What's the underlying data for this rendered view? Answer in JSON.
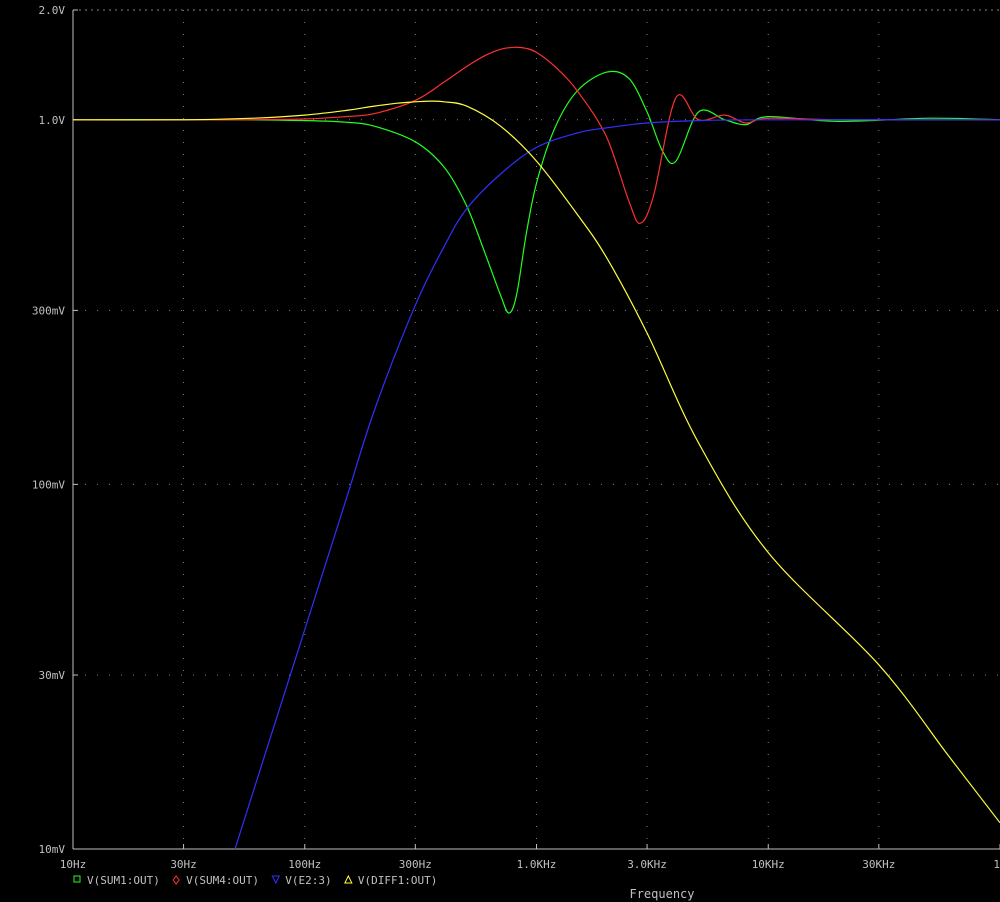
{
  "chart_data": {
    "type": "line",
    "xlabel": "Frequency",
    "xscale": "log",
    "yscale": "log",
    "xlim": [
      10,
      100000
    ],
    "ylim": [
      0.01,
      2.0
    ],
    "x_ticks": [
      {
        "value": 10,
        "label": "10Hz"
      },
      {
        "value": 30,
        "label": "30Hz"
      },
      {
        "value": 100,
        "label": "100Hz"
      },
      {
        "value": 300,
        "label": "300Hz"
      },
      {
        "value": 1000,
        "label": "1.0KHz"
      },
      {
        "value": 3000,
        "label": "3.0KHz"
      },
      {
        "value": 10000,
        "label": "10KHz"
      },
      {
        "value": 30000,
        "label": "30KHz"
      },
      {
        "value": 100000,
        "label": "1"
      }
    ],
    "y_ticks": [
      {
        "value": 2.0,
        "label": "2.0V"
      },
      {
        "value": 1.0,
        "label": "1.0V"
      },
      {
        "value": 0.3,
        "label": "300mV"
      },
      {
        "value": 0.1,
        "label": "100mV"
      },
      {
        "value": 0.03,
        "label": "30mV"
      },
      {
        "value": 0.01,
        "label": "10mV"
      }
    ],
    "grid": true,
    "legend_position": "bottom-left",
    "series": [
      {
        "name": "V(SUM1:OUT)",
        "color": "#20ff20",
        "marker": "square",
        "x": [
          10,
          50,
          100,
          150,
          200,
          300,
          400,
          500,
          600,
          700,
          760,
          820,
          900,
          1000,
          1200,
          1500,
          2000,
          2500,
          3000,
          3500,
          4000,
          5000,
          6500,
          8000,
          10000,
          20000,
          50000,
          100000
        ],
        "y": [
          1.0,
          1.0,
          0.995,
          0.985,
          0.96,
          0.87,
          0.74,
          0.58,
          0.43,
          0.33,
          0.295,
          0.33,
          0.48,
          0.67,
          0.95,
          1.2,
          1.35,
          1.3,
          1.05,
          0.82,
          0.77,
          1.05,
          1.0,
          0.97,
          1.02,
          0.99,
          1.01,
          1.0
        ]
      },
      {
        "name": "V(SUM4:OUT)",
        "color": "#ff3030",
        "marker": "diamond",
        "x": [
          10,
          50,
          100,
          150,
          200,
          300,
          400,
          500,
          600,
          700,
          800,
          900,
          1000,
          1200,
          1500,
          2000,
          2500,
          2800,
          3200,
          4000,
          5000,
          6500,
          8000,
          10000,
          20000,
          50000,
          100000
        ],
        "y": [
          1.0,
          1.0,
          1.005,
          1.02,
          1.04,
          1.13,
          1.27,
          1.4,
          1.5,
          1.56,
          1.58,
          1.57,
          1.53,
          1.4,
          1.2,
          0.9,
          0.6,
          0.52,
          0.62,
          1.15,
          1.0,
          1.03,
          0.98,
          1.01,
          1.0,
          1.0,
          1.0
        ]
      },
      {
        "name": "V(E2:3)",
        "color": "#3030ff",
        "marker": "triangle-down",
        "x": [
          50,
          100,
          150,
          200,
          300,
          400,
          500,
          700,
          1000,
          1500,
          2000,
          3000,
          5000,
          10000,
          100000
        ],
        "y": [
          0.01,
          0.04,
          0.09,
          0.16,
          0.31,
          0.45,
          0.57,
          0.71,
          0.84,
          0.92,
          0.95,
          0.98,
          0.995,
          1.0,
          1.0
        ]
      },
      {
        "name": "V(DIFF1:OUT)",
        "color": "#ffff40",
        "marker": "triangle-up",
        "x": [
          10,
          30,
          60,
          100,
          150,
          200,
          250,
          300,
          350,
          400,
          500,
          700,
          1000,
          1500,
          2000,
          3000,
          5000,
          10000,
          30000,
          60000,
          100000
        ],
        "y": [
          1.0,
          1.0,
          1.01,
          1.03,
          1.06,
          1.09,
          1.11,
          1.12,
          1.125,
          1.12,
          1.09,
          0.96,
          0.77,
          0.55,
          0.42,
          0.26,
          0.13,
          0.065,
          0.032,
          0.018,
          0.0118
        ]
      }
    ]
  }
}
